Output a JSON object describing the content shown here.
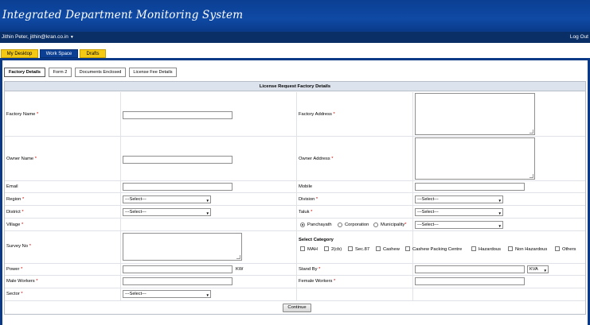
{
  "app": {
    "title": "Integrated Department Monitoring System"
  },
  "userbar": {
    "user": "Jithin Peter, jithin@kran.co.in",
    "caret": "▼",
    "logout": "Log Out"
  },
  "main_tabs": [
    {
      "label": "My Desktop"
    },
    {
      "label": "Work Space"
    },
    {
      "label": "Drafts"
    }
  ],
  "sub_tabs": [
    {
      "label": "Factory Details"
    },
    {
      "label": "Form 2"
    },
    {
      "label": "Documents Enclosed"
    },
    {
      "label": "License Fee Details"
    }
  ],
  "form": {
    "heading": "License Request Factory Details",
    "required_mark": "*",
    "labels": {
      "factory_name": "Factory Name",
      "factory_address": "Factory Address",
      "owner_name": "Owner Name",
      "owner_address": "Owner Address",
      "email": "Email",
      "mobile": "Mobile",
      "region": "Region",
      "division": "Division",
      "district": "District",
      "taluk": "Taluk",
      "village": "Village",
      "survey_no": "Survey No",
      "select_category": "Select Category",
      "power": "Power",
      "power_unit": "KW",
      "stand_by": "Stand By",
      "male_workers": "Male Workers",
      "female_workers": "Female Workers",
      "sector": "Sector"
    },
    "select_placeholder": "---Select---",
    "standby_unit": "KVA",
    "local_body_options": [
      "Panchayath",
      "Corporation",
      "Municipality"
    ],
    "local_body_selected": "Panchayath",
    "categories": [
      "MAH",
      "2(cb)",
      "Sec.87",
      "Cashew",
      "Cashew Packing Centre",
      "Hazardous",
      "Non Hazardous",
      "Others"
    ],
    "continue_label": "Continue"
  },
  "colors": {
    "header": "#0b3f93",
    "userbar": "#0a2e66",
    "tab_yellow": "#f3c913",
    "required": "#d40000",
    "panel_head": "#dde3ec"
  }
}
